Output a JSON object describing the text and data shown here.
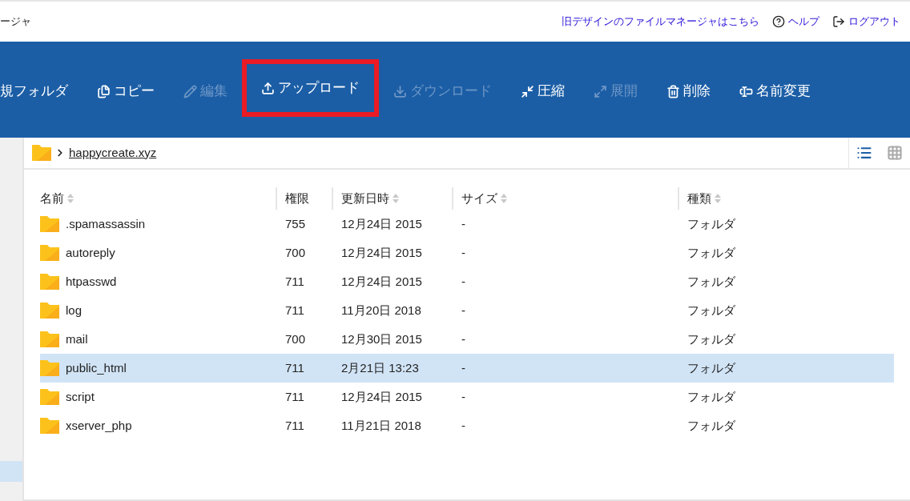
{
  "header": {
    "title": "ージャ",
    "links": [
      {
        "kind": "link",
        "label": "旧デザインのファイルマネージャはこちら"
      },
      {
        "kind": "help",
        "label": "ヘルプ"
      },
      {
        "kind": "logout",
        "label": "ログアウト"
      }
    ]
  },
  "toolbar": [
    {
      "kind": "folder",
      "label": "規フォルダ",
      "disabled": false,
      "highlighted": false
    },
    {
      "kind": "copy",
      "label": "コピー",
      "disabled": false,
      "highlighted": false
    },
    {
      "kind": "edit",
      "label": "編集",
      "disabled": true,
      "highlighted": false
    },
    {
      "kind": "upload",
      "label": "アップロード",
      "disabled": false,
      "highlighted": true
    },
    {
      "kind": "download",
      "label": "ダウンロード",
      "disabled": true,
      "highlighted": false
    },
    {
      "kind": "compress",
      "label": "圧縮",
      "disabled": false,
      "highlighted": false
    },
    {
      "kind": "expand",
      "label": "展開",
      "disabled": true,
      "highlighted": false
    },
    {
      "kind": "delete",
      "label": "削除",
      "disabled": false,
      "highlighted": false
    },
    {
      "kind": "rename",
      "label": "名前変更",
      "disabled": false,
      "highlighted": false
    }
  ],
  "sidebar": {
    "items": [
      {
        "selected": true
      }
    ]
  },
  "breadcrumb": {
    "path": "happycreate.xyz"
  },
  "view_toggle": [
    {
      "kind": "list",
      "selected": true
    },
    {
      "kind": "grid",
      "selected": false
    }
  ],
  "table": {
    "columns": [
      {
        "label": "名前",
        "sortable": true
      },
      {
        "label": "権限",
        "sortable": false
      },
      {
        "label": "更新日時",
        "sortable": true
      },
      {
        "label": "サイズ",
        "sortable": true
      },
      {
        "label": "種類",
        "sortable": true
      }
    ],
    "rows": [
      {
        "name": ".spamassassin",
        "permission": "755",
        "modified": "12月24日 2015",
        "size": "-",
        "type": "フォルダ",
        "selected": false
      },
      {
        "name": "autoreply",
        "permission": "700",
        "modified": "12月24日 2015",
        "size": "-",
        "type": "フォルダ",
        "selected": false
      },
      {
        "name": "htpasswd",
        "permission": "711",
        "modified": "12月24日 2015",
        "size": "-",
        "type": "フォルダ",
        "selected": false
      },
      {
        "name": "log",
        "permission": "711",
        "modified": "11月20日 2018",
        "size": "-",
        "type": "フォルダ",
        "selected": false
      },
      {
        "name": "mail",
        "permission": "700",
        "modified": "12月30日 2015",
        "size": "-",
        "type": "フォルダ",
        "selected": false
      },
      {
        "name": "public_html",
        "permission": "711",
        "modified": "2月21日 13:23",
        "size": "-",
        "type": "フォルダ",
        "selected": true
      },
      {
        "name": "script",
        "permission": "711",
        "modified": "12月24日 2015",
        "size": "-",
        "type": "フォルダ",
        "selected": false
      },
      {
        "name": "xserver_php",
        "permission": "711",
        "modified": "11月21日 2018",
        "size": "-",
        "type": "フォルダ",
        "selected": false
      }
    ]
  }
}
